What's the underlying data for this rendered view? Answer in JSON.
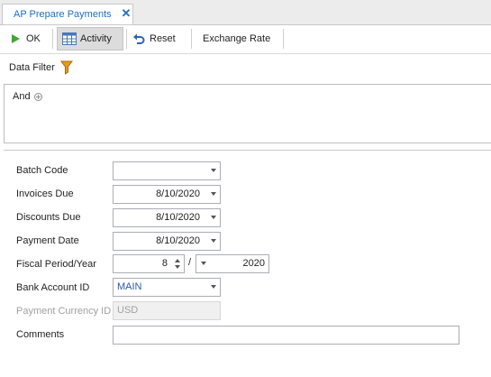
{
  "tab": {
    "title": "AP Prepare Payments",
    "close_glyph": "✕"
  },
  "toolbar": {
    "ok_label": "OK",
    "activity_label": "Activity",
    "reset_label": "Reset",
    "exchange_rate_label": "Exchange Rate"
  },
  "filter": {
    "label": "Data Filter",
    "and_label": "And"
  },
  "form": {
    "batch_code": {
      "label": "Batch Code",
      "value": ""
    },
    "invoices_due": {
      "label": "Invoices Due",
      "value": "8/10/2020"
    },
    "discounts_due": {
      "label": "Discounts Due",
      "value": "8/10/2020"
    },
    "payment_date": {
      "label": "Payment Date",
      "value": "8/10/2020"
    },
    "fiscal": {
      "label": "Fiscal Period/Year",
      "period": "8",
      "separator": "/",
      "year": "2020"
    },
    "bank_account": {
      "label": "Bank Account ID",
      "value": "MAIN"
    },
    "payment_currency": {
      "label": "Payment Currency ID",
      "value": "USD"
    },
    "comments": {
      "label": "Comments",
      "value": ""
    }
  },
  "colors": {
    "accent": "#1f6fc1",
    "ok_green": "#3aa832",
    "filter_orange": "#e89a1c",
    "link_blue": "#2a5aa8"
  }
}
